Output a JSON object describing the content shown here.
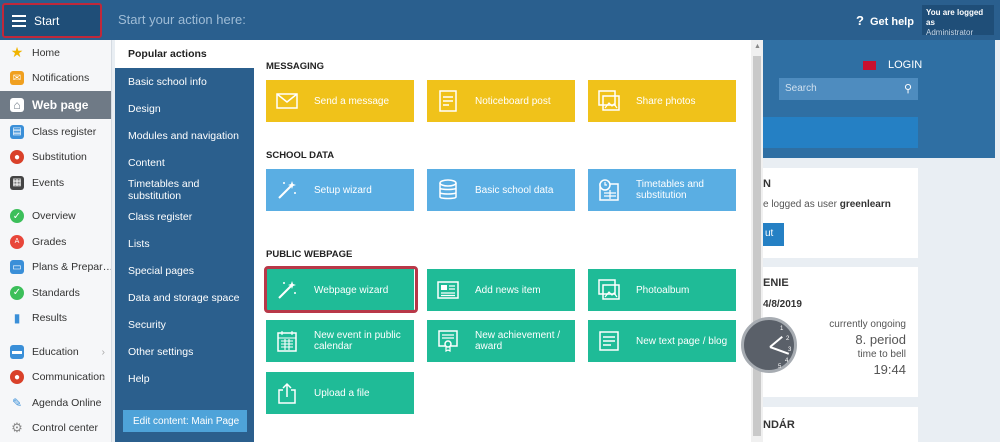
{
  "topbar": {
    "start_label": "Start",
    "prompt": "Start your action here:",
    "help_label": "Get help",
    "logged_as_label": "You are logged as",
    "logged_as_role": "Administrator"
  },
  "sidebar": {
    "items": [
      {
        "label": "Home",
        "icon": "star-icon",
        "color": "#f0b400"
      },
      {
        "label": "Notifications",
        "icon": "envelope-icon",
        "color": "#f0a020"
      },
      {
        "label": "Web page",
        "icon": "home-icon",
        "color": "#ffffff"
      },
      {
        "label": "Class register",
        "icon": "book-icon",
        "color": "#3a8fd8"
      },
      {
        "label": "Substitution",
        "icon": "user-icon",
        "color": "#d9412a"
      },
      {
        "label": "Events",
        "icon": "calendar-icon",
        "color": "#444444"
      },
      {
        "label": "Overview",
        "icon": "check-icon",
        "color": "#3cbf5a"
      },
      {
        "label": "Grades",
        "icon": "grade-icon",
        "color": "#e8463a"
      },
      {
        "label": "Plans & Prepar…",
        "icon": "plans-icon",
        "color": "#3a8fd8"
      },
      {
        "label": "Standards",
        "icon": "shield-icon",
        "color": "#3cbf5a"
      },
      {
        "label": "Results",
        "icon": "bar-chart-icon",
        "color": "#3a8fd8"
      },
      {
        "label": "Education",
        "icon": "education-icon",
        "color": "#3a8fd8"
      },
      {
        "label": "Communication",
        "icon": "chat-icon",
        "color": "#d9412a"
      },
      {
        "label": "Agenda Online",
        "icon": "pen-icon",
        "color": "#3a8fd8"
      },
      {
        "label": "Control center",
        "icon": "gear-icon",
        "color": "#888888"
      }
    ]
  },
  "menu": {
    "items": [
      "Popular actions",
      "Basic school info",
      "Design",
      "Modules and navigation",
      "Content",
      "Timetables and substitution",
      "Class register",
      "Lists",
      "Special pages",
      "Data and storage space",
      "Security",
      "Other settings",
      "Help"
    ],
    "edit_label": "Edit content: Main Page"
  },
  "panel": {
    "sections": {
      "messaging": "MESSAGING",
      "school_data": "SCHOOL DATA",
      "public_webpage": "PUBLIC WEBPAGE"
    },
    "tiles": {
      "send_message": "Send a message",
      "noticeboard": "Noticeboard post",
      "share_photos": "Share photos",
      "setup_wizard": "Setup wizard",
      "basic_data": "Basic school data",
      "timetables": "Timetables and substitution",
      "webpage_wizard": "Webpage wizard",
      "add_news": "Add news item",
      "photoalbum": "Photoalbum",
      "new_event": "New event in public calendar",
      "new_achievement": "New achievement / award",
      "new_text_page": "New text page / blog",
      "upload_file": "Upload a file"
    }
  },
  "background": {
    "login": "LOGIN",
    "search_placeholder": "Search",
    "card1_title": "N",
    "card1_text_prefix": "e logged as user ",
    "card1_user": "greenlearn",
    "card1_button": "ut",
    "card2_title": "ENIE",
    "card2_date": "4/8/2019",
    "status": "currently ongoing",
    "period": "8. period",
    "bell_label": "time to bell",
    "bell_time": "19:44",
    "card3_title": "NDÁR"
  }
}
